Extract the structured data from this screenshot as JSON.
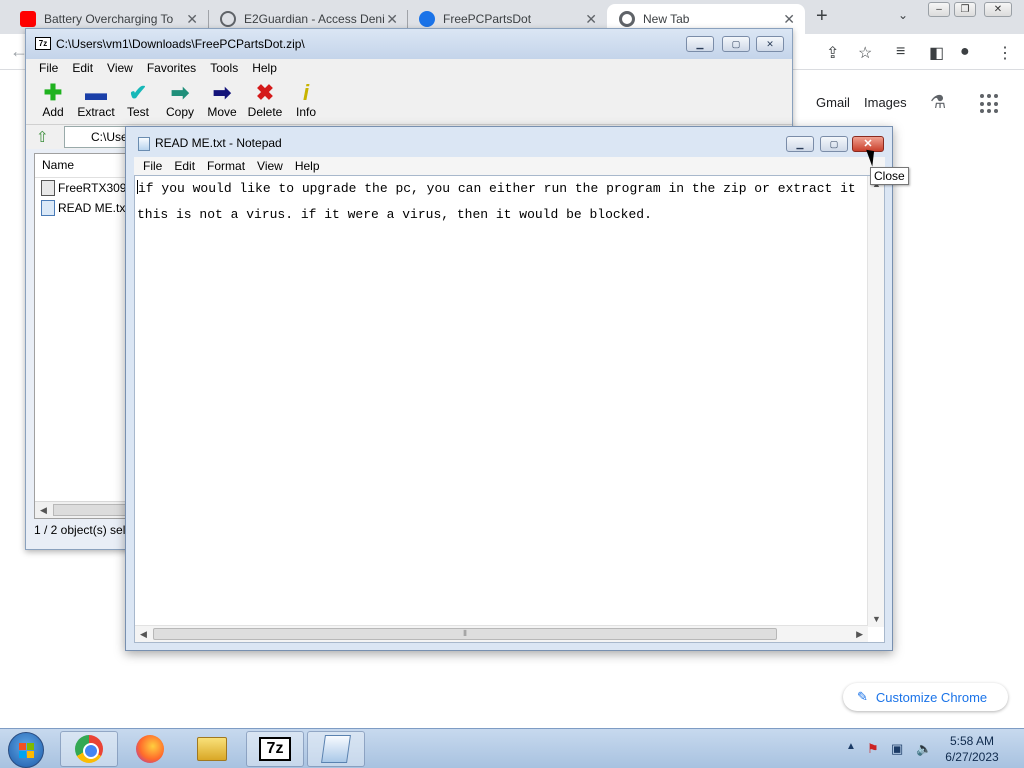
{
  "chrome": {
    "tabs": [
      {
        "title": "Battery Overcharging To",
        "favicon": "youtube-icon",
        "color": "#ff0000"
      },
      {
        "title": "E2Guardian - Access Deni",
        "favicon": "globe-icon",
        "color": "#5f6368"
      },
      {
        "title": "FreePCPartsDot",
        "favicon": "edge-logo-icon",
        "color": "#1a73e8"
      },
      {
        "title": "New Tab",
        "favicon": "chrome-icon",
        "color": "#5f6368"
      }
    ],
    "new_tab": "+",
    "newtab_links": {
      "gmail": "Gmail",
      "images": "Images"
    },
    "customize_label": "Customize Chrome"
  },
  "sevenzip": {
    "title": "C:\\Users\\vm1\\Downloads\\FreePCPartsDot.zip\\",
    "menu": [
      "File",
      "Edit",
      "View",
      "Favorites",
      "Tools",
      "Help"
    ],
    "toolbar": [
      {
        "label": "Add",
        "icon": "plus-icon",
        "color": "#1fb21f"
      },
      {
        "label": "Extract",
        "icon": "minus-icon",
        "color": "#1a3fa8"
      },
      {
        "label": "Test",
        "icon": "check-icon",
        "color": "#17b8b8"
      },
      {
        "label": "Copy",
        "icon": "double-arrow-icon",
        "color": "#1f8f7a"
      },
      {
        "label": "Move",
        "icon": "arrow-right-icon",
        "color": "#14147a"
      },
      {
        "label": "Delete",
        "icon": "x-icon",
        "color": "#d41a1a"
      },
      {
        "label": "Info",
        "icon": "info-icon",
        "color": "#c8b400"
      }
    ],
    "path_visible": "C:\\Use",
    "column_name": "Name",
    "files": [
      "FreeRTX3090.",
      "READ ME.txt"
    ],
    "status": "1 / 2 object(s) sel"
  },
  "notepad": {
    "title": "READ ME.txt - Notepad",
    "menu": [
      "File",
      "Edit",
      "Format",
      "View",
      "Help"
    ],
    "line1": "if you would like to upgrade the pc, you can either run the program in the zip or extract it",
    "line2": "this is not a virus. if it were a virus, then it would be blocked.",
    "close_tooltip": "Close"
  },
  "taskbar": {
    "apps": [
      "chrome",
      "firefox",
      "windows-explorer",
      "7-zip",
      "notepad"
    ],
    "clock_time": "5:58 AM",
    "clock_date": "6/27/2023"
  }
}
